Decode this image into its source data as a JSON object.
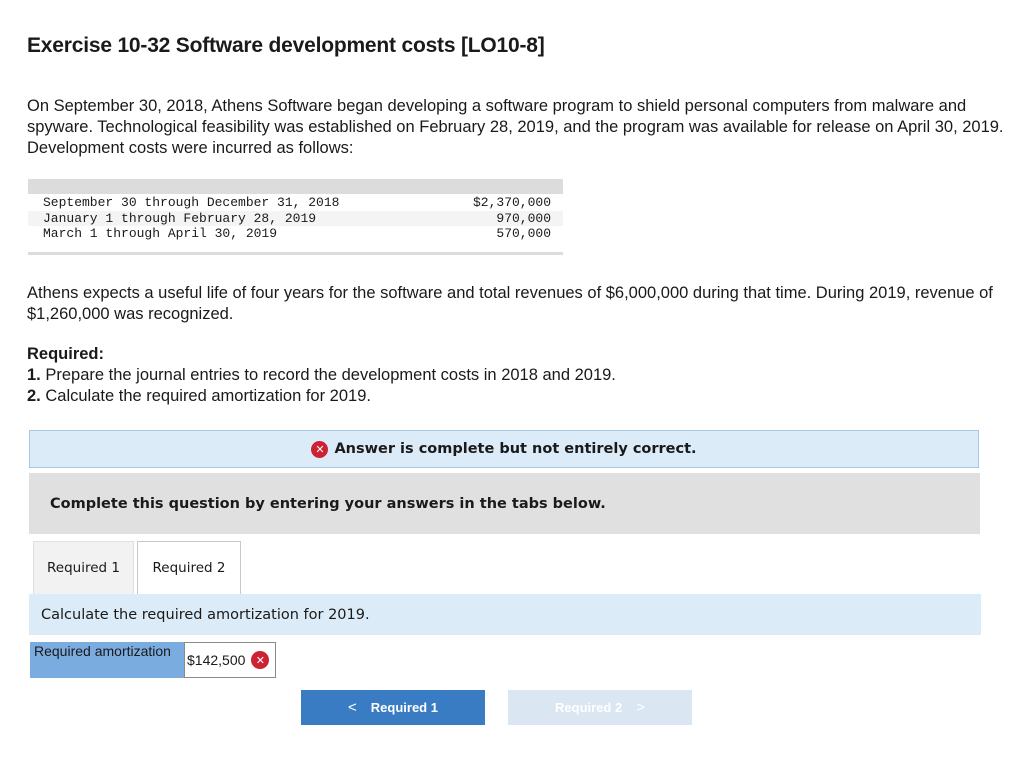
{
  "title": "Exercise 10-32 Software development costs [LO10-8]",
  "intro": "On September 30, 2018, Athens Software began developing a software program to shield personal computers from malware and spyware. Technological feasibility was established on February 28, 2019, and the program was available for release on April 30, 2019. Development costs were incurred as follows:",
  "costs": [
    {
      "period": "September 30 through December 31, 2018",
      "amount": "$2,370,000"
    },
    {
      "period": "January 1 through February 28, 2019",
      "amount": "970,000"
    },
    {
      "period": "March 1 through April 30, 2019",
      "amount": "570,000"
    }
  ],
  "expectations": "Athens expects a useful life of four years for the software and total revenues of $6,000,000 during that time. During 2019, revenue of $1,260,000 was recognized.",
  "required": {
    "heading": "Required:",
    "items": [
      {
        "num": "1.",
        "text": "Prepare the journal entries to record the development costs in 2018 and 2019."
      },
      {
        "num": "2.",
        "text": "Calculate the required amortization for 2019."
      }
    ]
  },
  "status": {
    "icon": "x-circle-icon",
    "text": "Answer is complete but not entirely correct."
  },
  "instruction": "Complete this question by entering your answers in the tabs below.",
  "tabs": [
    {
      "label": "Required 1"
    },
    {
      "label": "Required 2"
    }
  ],
  "question": "Calculate the required amortization for 2019.",
  "answer": {
    "label": "Required amortization",
    "currency": "$",
    "value": "142,500",
    "status": "incorrect"
  },
  "nav": {
    "prev_label": "Required 1",
    "next_label": "Required 2"
  },
  "colors": {
    "accent": "#3a7cc4",
    "error": "#cc2233",
    "info_bg": "#dbebf7"
  }
}
